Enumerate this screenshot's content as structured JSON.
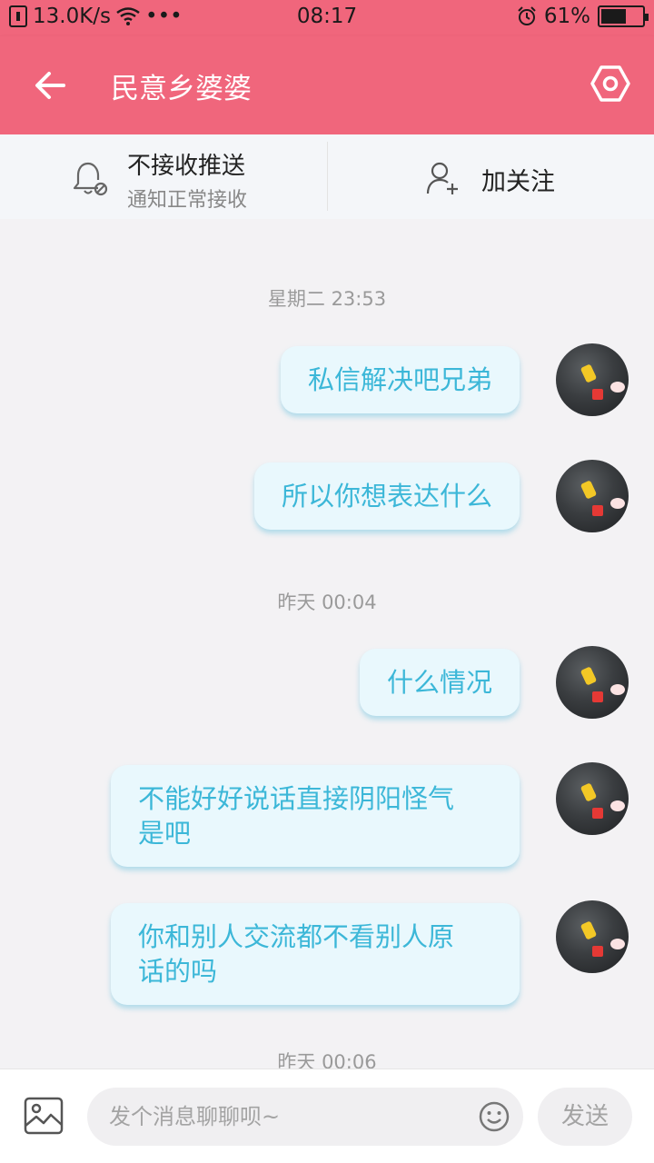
{
  "status_bar": {
    "speed": "13.0K/s",
    "dots": "•••",
    "time": "08:17",
    "battery": "61%",
    "battery_level": 0.61
  },
  "header": {
    "title": "民意乡婆婆",
    "color": "#f0667c"
  },
  "actions": {
    "push_title": "不接收推送",
    "push_subtitle": "通知正常接收",
    "follow_label": "加关注"
  },
  "chat": {
    "bubble_bg": "#e9f8fd",
    "bubble_text_color": "#3cb7d8",
    "timestamps": [
      "星期二 23:53",
      "昨天 00:04",
      "昨天 00:06"
    ],
    "messages": [
      {
        "text": "私信解决吧兄弟"
      },
      {
        "text": "所以你想表达什么"
      },
      {
        "text": "什么情况"
      },
      {
        "text": "不能好好说话直接阴阳怪气\n是吧"
      },
      {
        "text": "你和别人交流都不看别人原\n话的吗"
      }
    ]
  },
  "composer": {
    "placeholder": "发个消息聊聊呗~",
    "value": "",
    "send_label": "发送"
  },
  "icons": {
    "back": "arrow-left-icon",
    "settings": "hexagon-settings-icon",
    "bell": "bell-off-icon",
    "follow": "user-plus-icon",
    "image": "image-icon",
    "emoji": "smiley-icon"
  }
}
